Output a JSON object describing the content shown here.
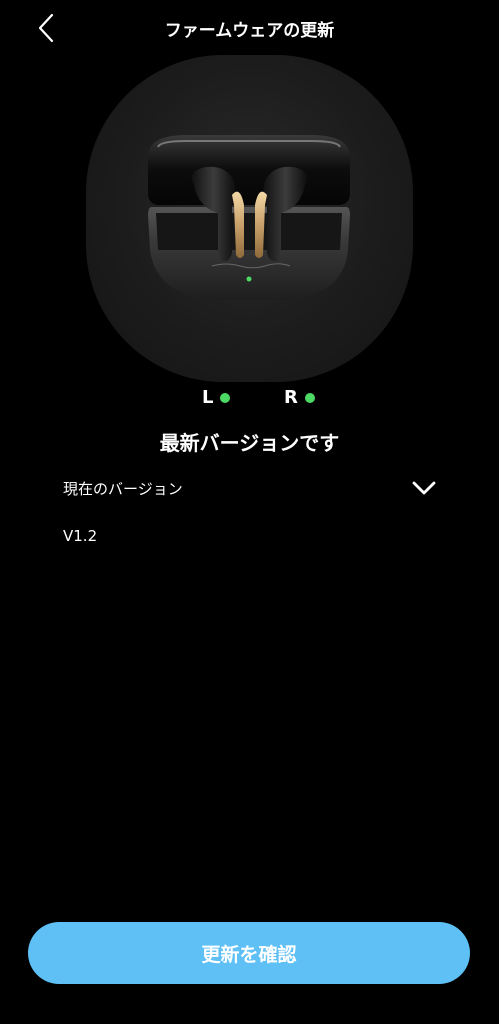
{
  "header": {
    "title": "ファームウェアの更新",
    "back_icon": "chevron-left-icon"
  },
  "device": {
    "image": "earbuds-in-charging-case",
    "left": {
      "label": "L",
      "connected": true
    },
    "right": {
      "label": "R",
      "connected": true
    },
    "indicator_color": "#4cd964"
  },
  "status": {
    "message": "最新バージョンです"
  },
  "version": {
    "label": "現在のバージョン",
    "value": "V1.2",
    "expand_icon": "chevron-down-icon"
  },
  "actions": {
    "check_update_label": "更新を確認",
    "button_color": "#5ec0f5"
  }
}
